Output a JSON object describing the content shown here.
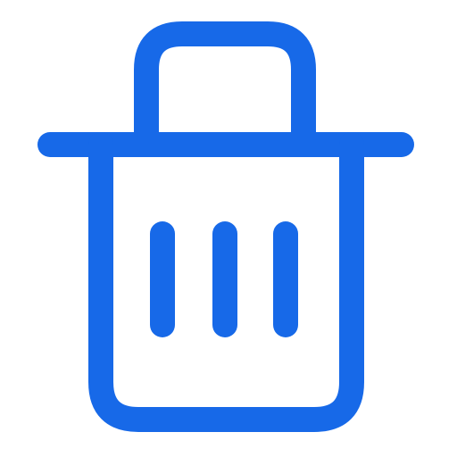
{
  "icon": {
    "name": "trash-icon",
    "color": "#1769E8",
    "background": "#FFFFFF"
  }
}
